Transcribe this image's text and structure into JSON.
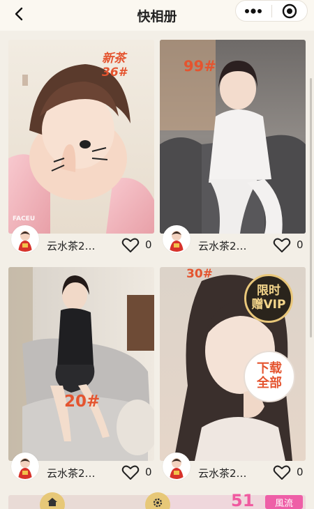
{
  "nav": {
    "title": "快相册"
  },
  "cards": [
    {
      "author": "云水茶2…",
      "likes": "0",
      "tag": "新茶 36#"
    },
    {
      "author": "云水茶2…",
      "likes": "0",
      "tag": "99#"
    },
    {
      "author": "云水茶2…",
      "likes": "0",
      "tag": "20#"
    },
    {
      "author": "云水茶2…",
      "likes": "0",
      "tag": "30#",
      "promo_vip": "限时\n赠VIP",
      "promo_download": "下载\n全部"
    }
  ],
  "photo_text": {
    "faceu": "FACEU"
  },
  "bottom": {
    "tag_51": "51",
    "tag_fengliu": "風流"
  },
  "colors": {
    "accent_red": "#e4542f",
    "nav_bg": "#fbf8f1",
    "page_bg": "#f3efe7",
    "vip_gold": "#e9c77a"
  }
}
